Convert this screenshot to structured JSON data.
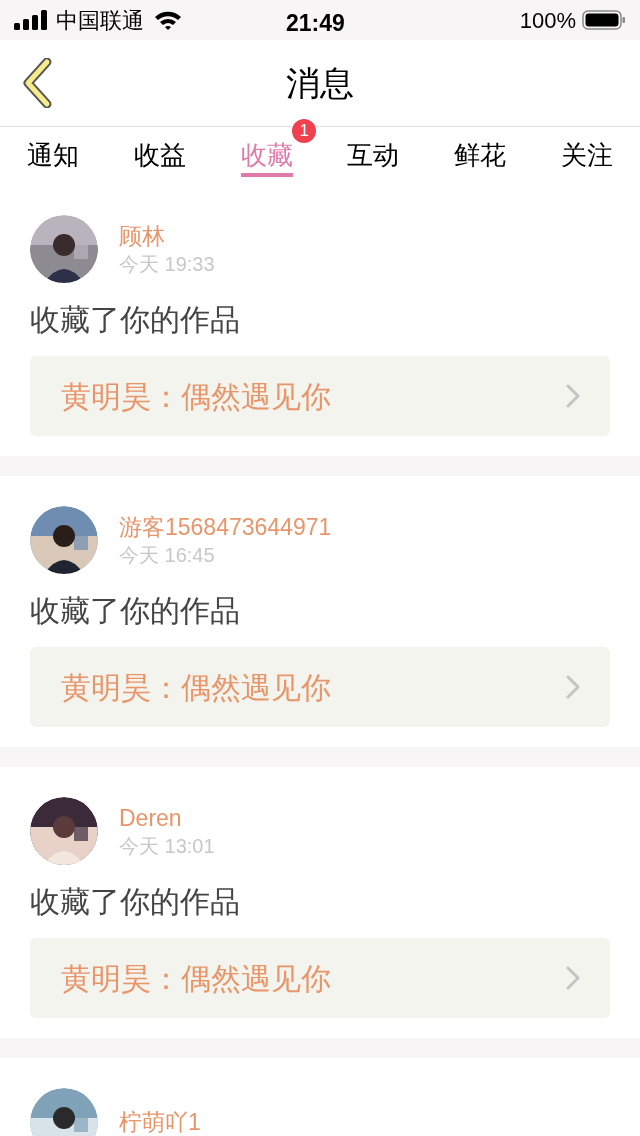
{
  "status_bar": {
    "carrier": "中国联通",
    "time": "21:49",
    "battery": "100%"
  },
  "nav": {
    "title": "消息"
  },
  "tabs": [
    {
      "label": "通知",
      "selected": false
    },
    {
      "label": "收益",
      "selected": false
    },
    {
      "label": "收藏",
      "selected": true,
      "badge": "1"
    },
    {
      "label": "互动",
      "selected": false
    },
    {
      "label": "鲜花",
      "selected": false
    },
    {
      "label": "关注",
      "selected": false
    }
  ],
  "messages": [
    {
      "user": "顾林",
      "time": "今天 19:33",
      "action": "收藏了你的作品",
      "work": "黄明昊：偶然遇见你"
    },
    {
      "user": "游客1568473644971",
      "time": "今天 16:45",
      "action": "收藏了你的作品",
      "work": "黄明昊：偶然遇见你"
    },
    {
      "user": "Deren",
      "time": "今天 13:01",
      "action": "收藏了你的作品",
      "work": "黄明昊：偶然遇见你"
    },
    {
      "user": "柠萌吖1"
    }
  ]
}
